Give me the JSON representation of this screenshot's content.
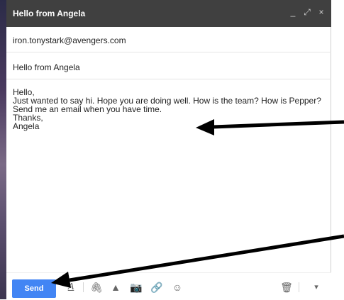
{
  "window": {
    "title": "Hello from Angela"
  },
  "titlebar_icons": [
    "minimize-icon",
    "expand-icon",
    "close-icon"
  ],
  "titlebar_glyphs": {
    "minimize": "_",
    "expand": "⤢",
    "close": "×"
  },
  "to": {
    "value": "iron.tonystark@avengers.com"
  },
  "subject": {
    "value": "Hello from Angela"
  },
  "body_lines": [
    "Hello,",
    "Just wanted to say hi. Hope you are doing well. How is the team? How is Pepper?",
    "Send me an email when you have time.",
    "Thanks,",
    "Angela"
  ],
  "toolbar": {
    "send_label": "Send",
    "icons": {
      "formatting": "A",
      "attach": "🖇",
      "drive": "▲",
      "photo": "📷",
      "link": "🔗",
      "emoji": "☺",
      "delete": "🗑",
      "more": "▾"
    }
  },
  "colors": {
    "titlebar": "#404040",
    "send_button": "#4285f4",
    "arrow": "#000000"
  }
}
